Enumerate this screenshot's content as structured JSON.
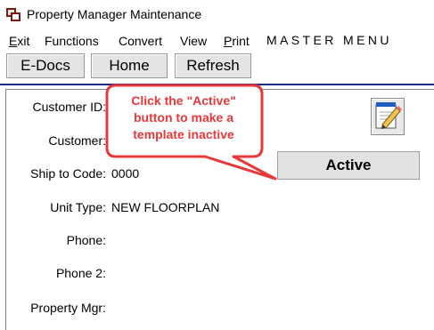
{
  "window": {
    "title": "Property Manager Maintenance"
  },
  "menu": {
    "items": [
      {
        "label": "Exit"
      },
      {
        "label": "Functions"
      },
      {
        "label": "Convert"
      },
      {
        "label": "View"
      },
      {
        "label": "Print"
      }
    ],
    "master_menu": "MASTER MENU"
  },
  "toolbar": {
    "edocs_label": "E-Docs",
    "home_label": "Home",
    "refresh_label": "Refresh"
  },
  "form": {
    "customer_id_label": "Customer ID:",
    "customer_label": "Customer:",
    "ship_to_code_label": "Ship to Code:",
    "ship_to_code_value": "0000",
    "unit_type_label": "Unit Type:",
    "unit_type_value": "NEW FLOORPLAN",
    "phone_label": "Phone:",
    "phone2_label": "Phone 2:",
    "property_mgr_label": "Property Mgr:"
  },
  "active_button": {
    "label": "Active"
  },
  "callout": {
    "line1": "Click the \"Active\"",
    "line2": "button to make a",
    "line3": "template inactive",
    "color": "#e8383a"
  },
  "icons": {
    "edit": "notepad-pencil-icon",
    "app": "app-windows-icon"
  }
}
